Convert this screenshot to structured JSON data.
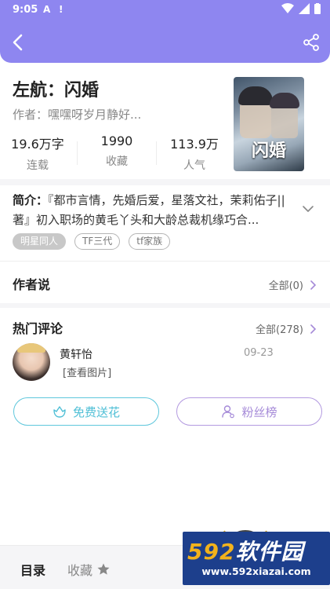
{
  "status_bar": {
    "time": "9:05",
    "icon_a": "A",
    "icon_warn": "!"
  },
  "header": {
    "back_icon": "chevron-left",
    "share_icon": "share"
  },
  "book": {
    "title": "左航：闪婚",
    "author_label": "作者：",
    "author_name": "嘿嘿呀岁月静好...",
    "cover_title": "闪婚",
    "stats": [
      {
        "value": "19.6万字",
        "label": "连载"
      },
      {
        "value": "1990",
        "label": "收藏"
      },
      {
        "value": "113.9万",
        "label": "人气"
      }
    ]
  },
  "intro": {
    "label": "简介：",
    "text": "『都市言情，先婚后爱，星落文社，茉莉佑子||著』初入职场的黄毛丫头和大龄总裁机缘巧合..."
  },
  "tags": [
    {
      "label": "明星同人",
      "style": "filled"
    },
    {
      "label": "TF三代",
      "style": "outline"
    },
    {
      "label": "tf家族",
      "style": "outline"
    }
  ],
  "author_says": {
    "title": "作者说",
    "more": "全部(0)"
  },
  "hot_comments": {
    "title": "热门评论",
    "more": "全部(278)",
    "items": [
      {
        "name": "黄轩怡",
        "date": "09-23",
        "text": "[查看图片]"
      }
    ]
  },
  "actions": {
    "flower": "免费送花",
    "fans": "粉丝榜"
  },
  "bottom_bar": {
    "toc": "目录",
    "favorite": "收藏"
  },
  "watermark": {
    "logo_num": "592",
    "logo_text": "软件园",
    "url": "www.592xiazai.com"
  },
  "colors": {
    "header": "#8e86f0",
    "flower": "#4fbfd6",
    "fans": "#a58ad8",
    "watermark_bg": "#1d3f8c"
  }
}
